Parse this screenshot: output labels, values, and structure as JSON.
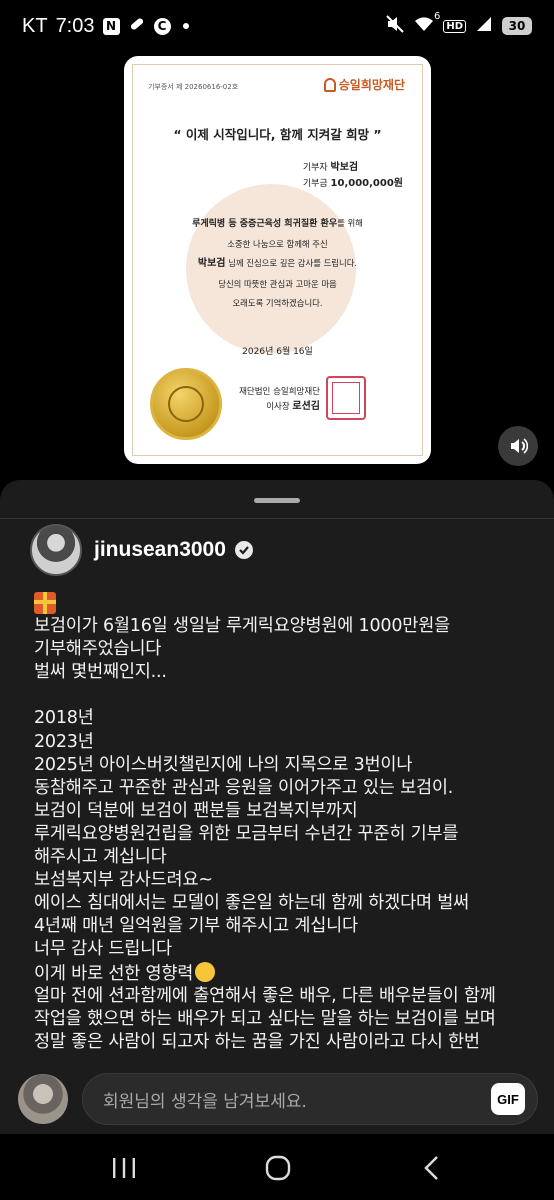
{
  "status_bar": {
    "carrier": "KT",
    "time": "7:03",
    "notif_icons": [
      "N",
      "C"
    ],
    "signal_sup": "6",
    "hd_label": "HD",
    "battery": "30"
  },
  "certificate": {
    "cert_number": "기부증서 제 20260616-02호",
    "logo_text": "승일희망재단",
    "title": "“ 이제 시작입니다, 함께 지켜갈 희망 ”",
    "donor_label": "기부자",
    "donor_name": "박보검",
    "amount_label": "기부금",
    "amount": "10,000,000원",
    "line1_bold": "루게릭병 등 중증근육성 희귀질환 환우",
    "line1_rest": "를 위해",
    "line2": "소중한 나눔으로 함께해 주신",
    "line3_name": "박보검",
    "line3_rest": " 님께 진심으로 깊은 감사를 드립니다.",
    "line4": "당신의 따뜻한 관심과 고마운 마음",
    "line5": "오래도록 기억하겠습니다.",
    "date": "2026년  6월  16일",
    "org": "재단법인 승일희망재단",
    "chair_label": "이사장",
    "chair_name": "로션김"
  },
  "post": {
    "username": "jinusean3000",
    "caption_lines": [
      "보검이가 6월16일 생일날 루게릭요양병원에 1000만원을",
      "기부해주었습니다",
      "벌써 몇번째인지...",
      "",
      "2018년",
      "2023년",
      "2025년 아이스버킷챌린지에 나의 지목으로 3번이나",
      "동참해주고 꾸준한 관심과 응원을 이어가주고 있는 보검이.",
      "보검이 덕분에 보검이 팬분들 보검복지부까지",
      "루게릭요양병원건립을 위한 모금부터 수년간 꾸준히 기부를",
      "해주시고 계십니다",
      "보섬복지부 감사드려요~",
      "에이스 침대에서는 모델이 좋은일 하는데 함께 하겠다며 벌써",
      "4년째 매년 일억원을 기부 해주시고 계십니다",
      "너무 감사 드립니다",
      "이게 바로 선한 영향력",
      "얼마 전에 션과함께에 출연해서 좋은 배우, 다른 배우분들이 함께",
      "작업을 했으면 하는 배우가 되고 싶다는 말을 하는 보검이를 보며",
      "정말 좋은 사람이 되고자 하는 꿈을 가진 사람이라고 다시 한번"
    ]
  },
  "comment": {
    "placeholder": "회원님의 생각을 남겨보세요.",
    "gif_label": "GIF"
  }
}
